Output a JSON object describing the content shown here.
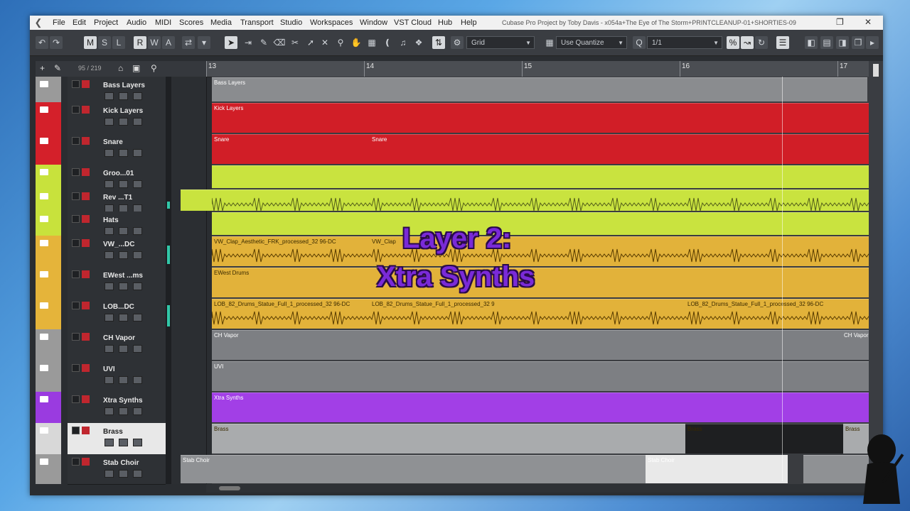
{
  "menu": {
    "items": [
      "File",
      "Edit",
      "Project",
      "Audio",
      "MIDI",
      "Scores",
      "Media",
      "Transport",
      "Studio",
      "Workspaces",
      "Window",
      "VST Cloud",
      "Hub",
      "Help"
    ],
    "window_title": "Cubase Pro Project by Toby Davis - x054a+The Eye of The Storm+PRINTCLEANUP-01+SHORTIES-09"
  },
  "toolbar": {
    "mode_letters": [
      "M",
      "S",
      "L",
      "R",
      "W",
      "A"
    ],
    "snap_type": "Grid",
    "quantize_mode": "Use Quantize",
    "quantize_value": "1/1"
  },
  "track_list": {
    "count_label": "95 / 219"
  },
  "ruler": {
    "bars": [
      "13",
      "14",
      "15",
      "16",
      "17"
    ]
  },
  "overlay": {
    "line1": "Layer 2:",
    "line2": "Xtra Synths"
  },
  "tracks": [
    {
      "name": "Bass Layers",
      "color": "#9a9a9a",
      "event_color": "#8a8c8f",
      "events": [
        {
          "label": "Bass Layers"
        }
      ]
    },
    {
      "name": "Kick Layers",
      "color": "#d4202a",
      "event_color": "#d11e27",
      "events": [
        {
          "label": "Kick Layers"
        }
      ]
    },
    {
      "name": "Snare",
      "color": "#d4202a",
      "event_color": "#d11e27",
      "events": [
        {
          "label": "Snare"
        },
        {
          "label": "Snare"
        }
      ]
    },
    {
      "name": "Groo...01",
      "color": "#c8e23c",
      "event_color": "#c9e33f",
      "events": []
    },
    {
      "name": "Rev ...T1",
      "color": "#c8e23c",
      "event_color": "#c9e33f",
      "events": []
    },
    {
      "name": "Hats",
      "color": "#c8e23c",
      "event_color": "#c9e33f",
      "events": []
    },
    {
      "name": "VW_...DC",
      "color": "#e5b43a",
      "event_color": "#e2b23a",
      "events": [
        {
          "label": "VW_Clap_Aesthetic_FRK_processed_32 96-DC"
        },
        {
          "label": "VW_Clap"
        }
      ]
    },
    {
      "name": "EWest ...ms",
      "color": "#e5b43a",
      "event_color": "#e2b23a",
      "events": [
        {
          "label": "EWest Drums"
        }
      ]
    },
    {
      "name": "LOB...DC",
      "color": "#e5b43a",
      "event_color": "#e2b23a",
      "events": [
        {
          "label": "LOB_82_Drums_Statue_Full_1_processed_32 96-DC"
        },
        {
          "label": "LOB_82_Drums_Statue_Full_1_processed_32 9"
        },
        {
          "label": "LOB_82_Drums_Statue_Full_1_processed_32 96-DC"
        }
      ]
    },
    {
      "name": "CH Vapor",
      "color": "#9a9a9a",
      "event_color": "#7d7f83",
      "events": [
        {
          "label": "CH Vapor"
        },
        {
          "label": "CH Vapor"
        }
      ]
    },
    {
      "name": "UVI",
      "color": "#9a9a9a",
      "event_color": "#7d7f83",
      "events": [
        {
          "label": "UVI"
        }
      ]
    },
    {
      "name": "Xtra Synths",
      "color": "#9a3be0",
      "event_color": "#a23fe6",
      "events": [
        {
          "label": "Xtra Synths"
        }
      ]
    },
    {
      "name": "Brass",
      "color": "#d8d8d8",
      "event_color": "#a9abad",
      "events": [
        {
          "label": "Brass"
        },
        {
          "label": "Brass"
        },
        {
          "label": "Brass"
        }
      ]
    },
    {
      "name": "Stab Choir",
      "color": "#9a9a9a",
      "event_color": "#8f9194",
      "events": [
        {
          "label": "Stab Choir"
        },
        {
          "label": "Stab Choir"
        }
      ]
    }
  ]
}
